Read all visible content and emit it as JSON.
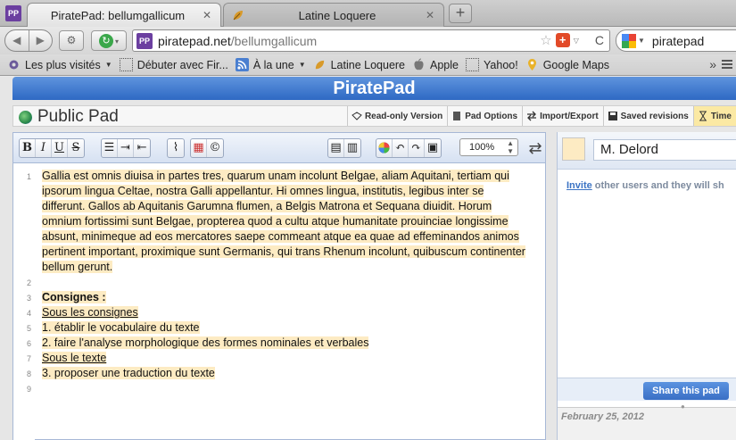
{
  "browser": {
    "tabs": [
      {
        "title": "PiratePad: bellumgallicum",
        "active": true,
        "favicon": "PP"
      },
      {
        "title": "Latine Loquere",
        "active": false,
        "favicon": "leaf-icon"
      }
    ],
    "new_tab": "+",
    "url_host": "piratepad.net",
    "url_path": "/bellumgallicum",
    "url_favicon": "PP",
    "search_text": "piratepad",
    "bookmarks": [
      {
        "label": "Les plus visités",
        "icon": "gear-icon",
        "dropdown": true
      },
      {
        "label": "Débuter avec Fir...",
        "icon": "dotted-page-icon",
        "dropdown": false
      },
      {
        "label": "À la une",
        "icon": "rss-icon",
        "dropdown": true
      },
      {
        "label": "Latine Loquere",
        "icon": "leaf-icon",
        "dropdown": false
      },
      {
        "label": "Apple",
        "icon": "apple-icon",
        "dropdown": false
      },
      {
        "label": "Yahoo!",
        "icon": "dotted-page-icon",
        "dropdown": false
      },
      {
        "label": "Google Maps",
        "icon": "map-pin-icon",
        "dropdown": false
      }
    ],
    "more_glyph": "»"
  },
  "pad": {
    "brand": "PiratePad",
    "title": "Public Pad",
    "links": [
      {
        "label": "Read-only Version",
        "icon": "glasses-icon"
      },
      {
        "label": "Pad Options",
        "icon": "page-icon"
      },
      {
        "label": "Import/Export",
        "icon": "arrows-icon"
      },
      {
        "label": "Saved revisions",
        "icon": "save-icon"
      },
      {
        "label": "Time",
        "icon": "hourglass-icon"
      }
    ],
    "toolbar": {
      "bold": "B",
      "italic": "I",
      "underline": "U",
      "strike": "S",
      "zoom": "100%"
    },
    "paragraph": "Gallia est omnis diuisa in partes tres, quarum unam incolunt Belgae, aliam Aquitani, tertiam qui ipsorum lingua Celtae, nostra Galli appellantur. Hi omnes lingua, institutis, legibus inter se differunt. Gallos ab Aquitanis Garumna flumen, a Belgis Matrona et Sequana diuidit. Horum omnium fortissimi sunt Belgae, propterea quod a cultu atque humanitate prouinciae longissime absunt, minimeque ad eos mercatores saepe commeant atque ea quae ad effeminandos animos pertinent important, proximique sunt Germanis, qui trans Rhenum incolunt, quibuscum continenter bellum gerunt.",
    "lines": [
      {
        "n": "3",
        "text": "Consignes :",
        "style": "bold"
      },
      {
        "n": "4",
        "text": "Sous les consignes",
        "style": "underline"
      },
      {
        "n": "5",
        "text": "1. établir le vocabulaire du texte",
        "style": ""
      },
      {
        "n": "6",
        "text": "2. faire l'analyse morphologique des formes nominales et verbales",
        "style": ""
      },
      {
        "n": "7",
        "text": "Sous le texte",
        "style": "underline"
      },
      {
        "n": "8",
        "text": "3. proposer une traduction du texte",
        "style": ""
      },
      {
        "n": "9",
        "text": "",
        "style": ""
      }
    ],
    "line_numbers": {
      "first": "1",
      "second": "2"
    },
    "user_name": "M. Delord",
    "user_color": "#fdebc3",
    "invite_link": "Invite",
    "invite_rest": " other users and they will sh",
    "share_button": "Share this pad",
    "date": "February 25, 2012"
  }
}
